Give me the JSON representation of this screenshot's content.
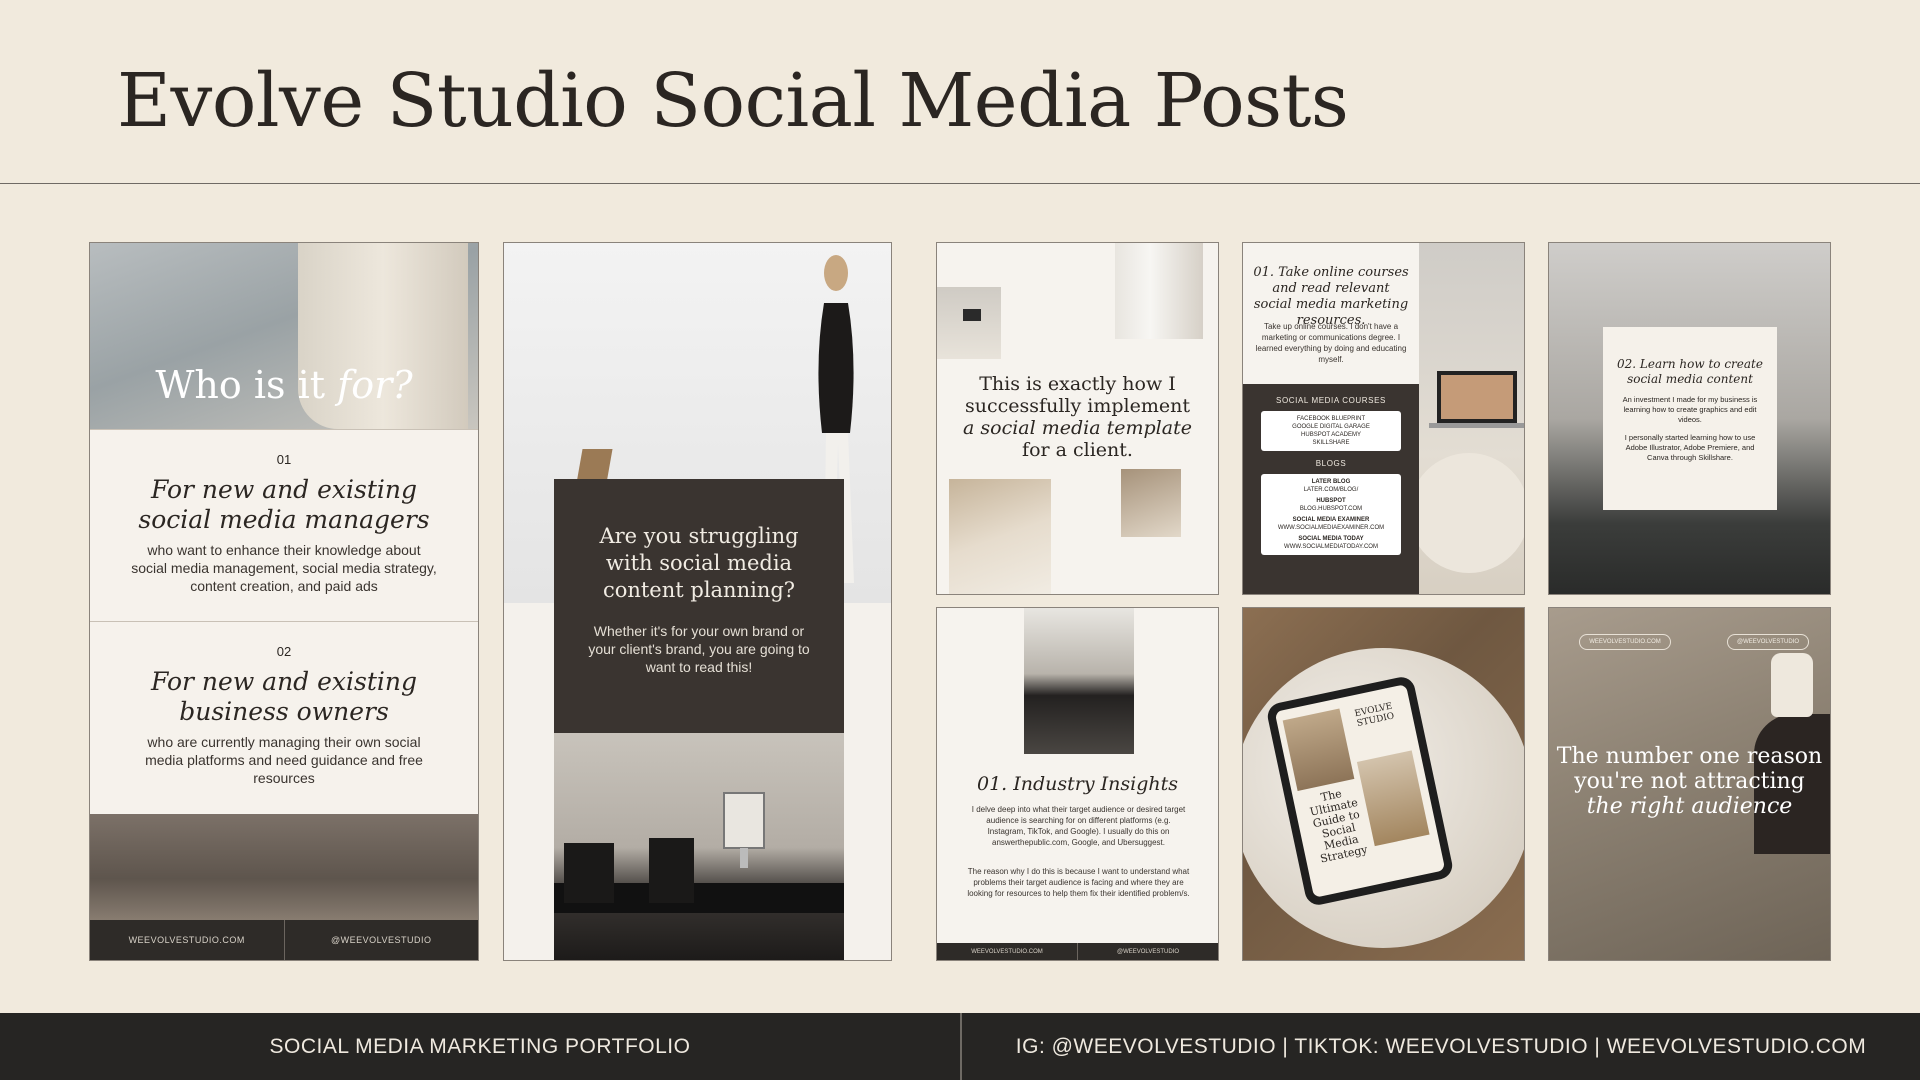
{
  "header": {
    "title": "Evolve Studio Social Media Posts"
  },
  "card1": {
    "heading": "Who is it",
    "heading_italic": "for?",
    "sections": [
      {
        "num": "01",
        "title_line1": "For new and existing",
        "title_line2": "social media managers",
        "body": "who want to enhance their knowledge about social media management, social media strategy, content creation, and paid ads"
      },
      {
        "num": "02",
        "title_line1": "For new and existing",
        "title_line2": "business owners",
        "body": "who are currently managing their own social media platforms and need guidance and free resources"
      }
    ],
    "footer_left": "WEEVOLVESTUDIO.COM",
    "footer_right": "@WEEVOLVESTUDIO"
  },
  "card2": {
    "heading": "Are you struggling with social media content planning?",
    "body": "Whether it's for your own brand or your client's brand, you are going to want to read this!"
  },
  "card3": {
    "line1": "This is exactly how I",
    "line2": "successfully implement",
    "line3": "a social media template",
    "line4": "for a client."
  },
  "card4": {
    "title": "01. Take online courses and read relevant social media marketing resources.",
    "body": "Take up online courses. I don't have a marketing or communications degree. I learned everything by doing and educating myself.",
    "courses_label": "SOCIAL MEDIA COURSES",
    "courses": [
      "FACEBOOK BLUEPRINT",
      "GOOGLE DIGITAL GARAGE",
      "HUBSPOT ACADEMY",
      "SKILLSHARE"
    ],
    "blogs_label": "BLOGS",
    "blogs": [
      {
        "name": "LATER BLOG",
        "url": "LATER.COM/BLOG/"
      },
      {
        "name": "HUBSPOT",
        "url": "BLOG.HUBSPOT.COM"
      },
      {
        "name": "SOCIAL MEDIA EXAMINER",
        "url": "WWW.SOCIALMEDIAEXAMINER.COM"
      },
      {
        "name": "SOCIAL MEDIA TODAY",
        "url": "WWW.SOCIALMEDIATODAY.COM"
      }
    ]
  },
  "card5": {
    "title": "02. Learn how to create social media content",
    "body1": "An investment I made for my business is learning how to create graphics and edit videos.",
    "body2": "I personally started learning how to use Adobe Illustrator, Adobe Premiere, and Canva through Skillshare."
  },
  "card6": {
    "title": "01. Industry Insights",
    "body1": "I delve deep into what their target audience or desired target audience is searching for on different platforms (e.g. Instagram, TikTok, and Google). I usually do this on answerthepublic.com, Google, and Ubersuggest.",
    "body2": "The reason why I do this is because I want to understand what problems their target audience is facing and where they are looking for resources to help them fix their identified problem/s.",
    "footer_left": "WEEVOLVESTUDIO.COM",
    "footer_right": "@WEEVOLVESTUDIO"
  },
  "card7": {
    "logo": "EVOLVE STUDIO",
    "title": "The Ultimate Guide to Social Media Strategy"
  },
  "card8": {
    "pill_left": "WEEVOLVESTUDIO.COM",
    "pill_right": "@WEEVOLVESTUDIO",
    "line1": "The number one reason",
    "line2": "you're not attracting",
    "line3": "the right audience"
  },
  "footer": {
    "left": "SOCIAL MEDIA MARKETING PORTFOLIO",
    "right": "IG: @WEEVOLVESTUDIO  |  TIKTOK: WEEVOLVESTUDIO  |  WEEVOLVESTUDIO.COM"
  },
  "colors": {
    "background": "#f1eadd",
    "dark": "#262523",
    "card_dark": "#3a3430"
  }
}
